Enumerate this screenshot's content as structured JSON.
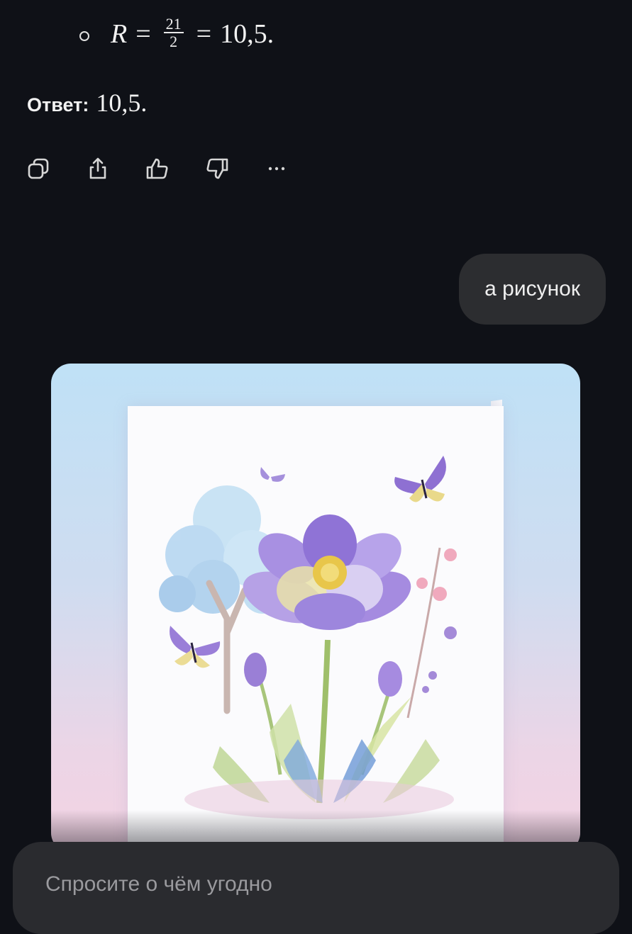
{
  "formula": {
    "variable": "R",
    "equals": "=",
    "numerator": "21",
    "denominator": "2",
    "result": "10,5."
  },
  "answer": {
    "label": "Ответ:",
    "value": "10,5."
  },
  "actions": [
    {
      "icon": "copy-icon"
    },
    {
      "icon": "share-icon"
    },
    {
      "icon": "thumbs-up-icon"
    },
    {
      "icon": "thumbs-down-icon"
    },
    {
      "icon": "more-icon"
    }
  ],
  "user_message": {
    "text": "а рисунок"
  },
  "generated_image": {
    "subject": "watercolor card with purple flower, tree and butterflies"
  },
  "composer": {
    "placeholder": "Спросите о чём угодно"
  },
  "colors": {
    "background": "#0f1117",
    "bubble": "#2c2d30",
    "composer": "#2a2b2f",
    "flower": "#9b82d8"
  }
}
